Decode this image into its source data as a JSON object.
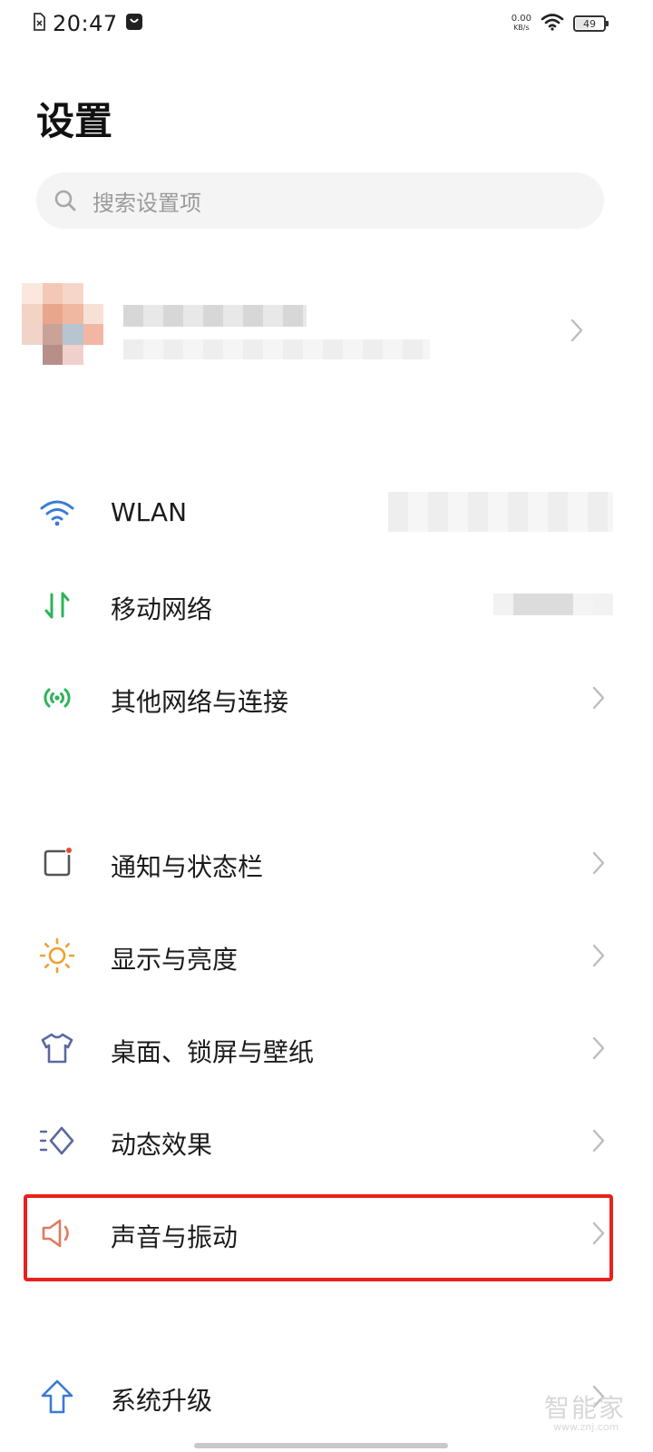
{
  "status_bar": {
    "time": "20:47",
    "net_speed_value": "0.00",
    "net_speed_unit": "KB/s",
    "battery_level": "49",
    "icons": [
      "sim-off-icon",
      "notification-icon",
      "wifi-icon",
      "battery-icon"
    ]
  },
  "page": {
    "title": "设置"
  },
  "search": {
    "placeholder": "搜索设置项"
  },
  "account": {
    "avatar": "pixelated-avatar",
    "name": "",
    "subtitle": ""
  },
  "settings": {
    "items": [
      {
        "label": "WLAN",
        "icon": "wifi-icon",
        "icon_color": "#3a7bd5"
      },
      {
        "label": "移动网络",
        "icon": "mobile-data-icon",
        "icon_color": "#2fb35a"
      },
      {
        "label": "其他网络与连接",
        "icon": "hotspot-icon",
        "icon_color": "#2fb35a"
      },
      {
        "label": "通知与状态栏",
        "icon": "notification-icon",
        "icon_color": "#555555"
      },
      {
        "label": "显示与亮度",
        "icon": "sun-icon",
        "icon_color": "#f0a030"
      },
      {
        "label": "桌面、锁屏与壁纸",
        "icon": "shirt-icon",
        "icon_color": "#5a6aa0"
      },
      {
        "label": "动态效果",
        "icon": "motion-icon",
        "icon_color": "#5a6aa0"
      },
      {
        "label": "声音与振动",
        "icon": "speaker-icon",
        "icon_color": "#e07a5f",
        "highlighted": true
      },
      {
        "label": "系统升级",
        "icon": "upgrade-icon",
        "icon_color": "#3a7bd5"
      }
    ]
  },
  "watermark": {
    "text": "智能家",
    "sub": "www.znj.com"
  },
  "colors": {
    "highlight_border": "#e8211d",
    "background": "#ffffff",
    "chevron": "#bdbdbd"
  }
}
